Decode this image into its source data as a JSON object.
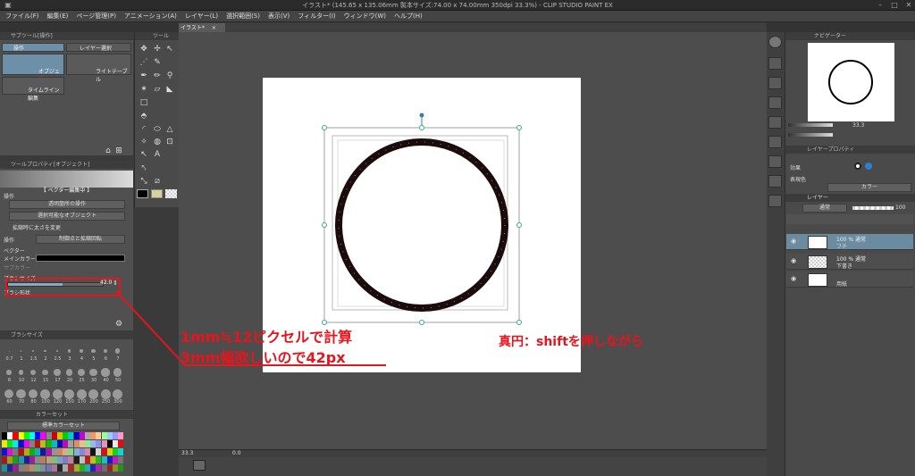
{
  "window": {
    "title": "イラスト* (145.65 x 135.06mm 製本サイズ:74.00 x 74.00mm 350dpi 33.3%) - CLIP STUDIO PAINT EX"
  },
  "menu": [
    "ファイル(F)",
    "編集(E)",
    "ページ管理(P)",
    "アニメーション(A)",
    "レイヤー(L)",
    "選択範囲(S)",
    "表示(V)",
    "フィルター(I)",
    "ウィンドウ(W)",
    "ヘルプ(H)"
  ],
  "canvas_tab": "イラスト*",
  "subtool": {
    "header": "サブツール[操作]",
    "items": [
      "操作",
      "レイヤー選択",
      "オブジェクト",
      "ライトテーブル",
      "タイムライン編集"
    ]
  },
  "tool_property": {
    "header": "ツールプロパティ[オブジェクト]",
    "mode": "【 ベクター編集中 】",
    "section_op": "操作",
    "op_value1": "透明箇所の操作",
    "op_value2": "選択可能なオブジェクト",
    "check_label": "拡縮時に太さを変更",
    "op_label": "操作",
    "op_value3": "制御点と拡縮回転",
    "vector_label": "ベクター",
    "main_color_label": "メインカラー",
    "sub_color_label": "サブカラー",
    "brush_size_label": "ブラシサイズ",
    "brush_size_value": "42.0",
    "brush_shape_label": "ブラシ形状"
  },
  "brush_size_panel": {
    "header": "ブラシサイズ",
    "sizes_row1": [
      "0.7",
      "1",
      "1.5",
      "2",
      "2.5",
      "3",
      "4",
      "5",
      "6",
      "7"
    ],
    "sizes_row2": [
      "8",
      "10",
      "12",
      "15",
      "17",
      "20",
      "25",
      "30",
      "40",
      "50"
    ],
    "sizes_row3": [
      "60",
      "70",
      "80",
      "100",
      "120",
      "150",
      "170",
      "200",
      "250",
      "300"
    ]
  },
  "color_set": {
    "tab": "カラーセット",
    "name": "標準カラーセット"
  },
  "right_panel": {
    "navigator_tab": "ナビゲーター",
    "zoom": "33.3",
    "layer_prop_tab": "レイヤープロパティ",
    "effect_label": "効果",
    "display_color_label": "表現色",
    "display_color_value": "カラー",
    "layer_tab": "レイヤー",
    "blend_mode": "通常",
    "opacity": "100",
    "layers": [
      {
        "mode": "100 % 通常",
        "name": "フチ",
        "selected": true
      },
      {
        "mode": "100 % 通常",
        "name": "下書き",
        "selected": false
      },
      {
        "mode": "",
        "name": "用紙",
        "selected": false
      }
    ]
  },
  "statusbar": {
    "zoom": "33.3",
    "angle": "0.0"
  },
  "annotations": {
    "note1": "1mm≒12ピクセルで計算",
    "note2": "3mm幅欲しいので42px",
    "note3": "真円：shiftを押しながら"
  },
  "colors": {
    "annotation_red": "#e8141b",
    "selection_blue": "#6b8ba0",
    "circle_fill": "#1a0c0c",
    "handle_teal": "#3aa58f"
  }
}
